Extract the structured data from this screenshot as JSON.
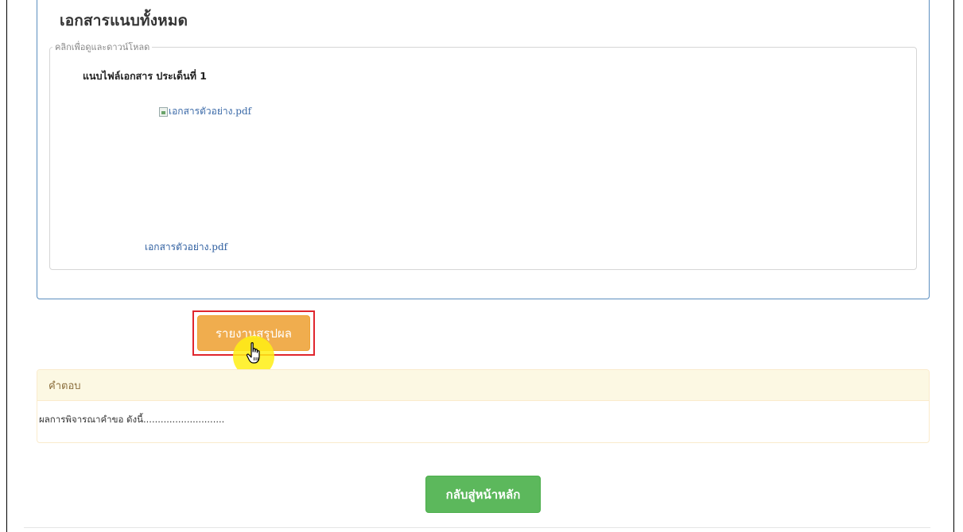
{
  "attachments_panel": {
    "title": "เอกสารแนบทั้งหมด",
    "legend": "คลิกเพื่อดูและดาวน์โหลด",
    "attachment_label": "แนบไฟล์เอกสาร ประเด็นที่ 1",
    "preview_alt": "เอกสารตัวอย่าง.pdf",
    "file_link": "เอกสารตัวอย่าง.pdf"
  },
  "report_button": {
    "label": "รายงานสรุปผล"
  },
  "answer_panel": {
    "heading": "คำตอบ",
    "body": "ผลการพิจารณาคำขอ ดังนี้............................"
  },
  "home_button": {
    "label": "กลับสู่หน้าหลัก"
  },
  "colors": {
    "report_button": "#f0ad4e",
    "home_button": "#5cb85c",
    "highlight_border": "#e0262e",
    "cursor_highlight": "#ffee14",
    "panel_border": "#5b8ebf",
    "answer_heading_bg": "#fcf8e3"
  }
}
